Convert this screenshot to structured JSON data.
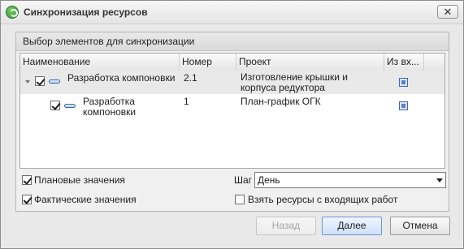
{
  "window": {
    "title": "Синхронизация ресурсов",
    "close_glyph": "✕"
  },
  "group": {
    "title": "Выбор элементов для синхронизации"
  },
  "grid": {
    "columns": [
      "Наименование",
      "Номер",
      "Проект",
      "Из вх..."
    ],
    "rows": [
      {
        "name": "Разработка компоновки",
        "number": "2.1",
        "project": "Изготовление крышки и корпуса редуктора",
        "checked": true
      },
      {
        "name": "Разработка компоновки",
        "number": "1",
        "project": "План-график ОГК",
        "checked": true
      }
    ]
  },
  "options": {
    "planned_label": "Плановые значения",
    "actual_label": "Фактические значения",
    "step_label": "Шаг",
    "step_value": "День",
    "take_resources_label": "Взять ресурсы с входящих работ"
  },
  "buttons": {
    "back": "Назад",
    "next": "Далее",
    "cancel": "Отмена"
  },
  "colors": {
    "accent": "#6f95cf",
    "selected_row": "#e9e9e9",
    "icon_blue": "#3b67b1"
  }
}
